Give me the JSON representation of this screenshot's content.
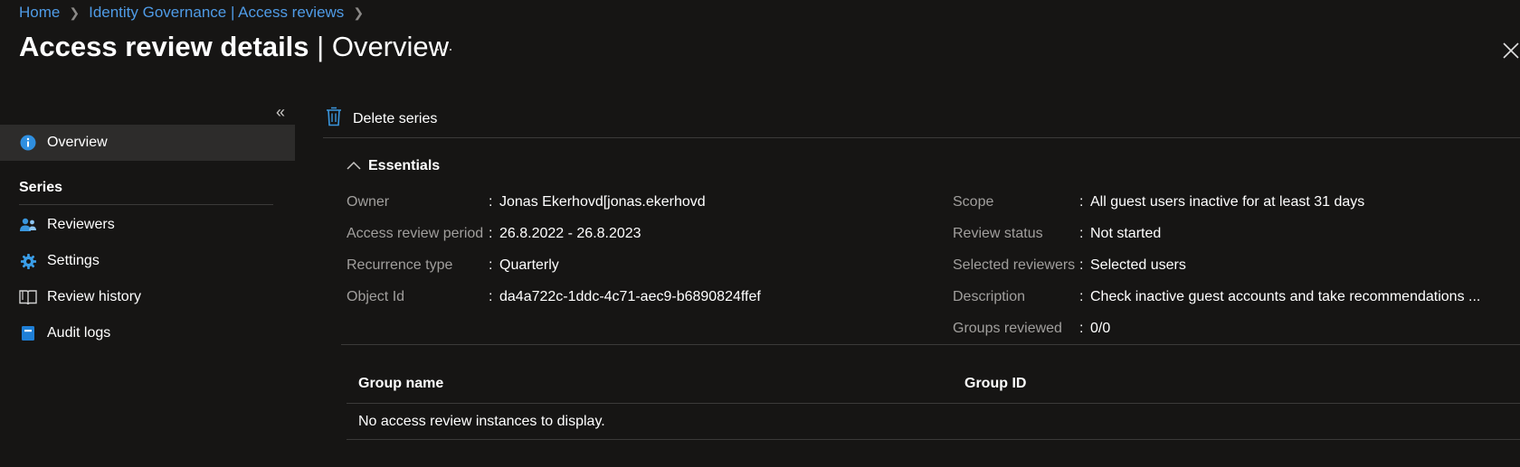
{
  "breadcrumb": {
    "items": [
      "Home",
      "Identity Governance | Access reviews"
    ]
  },
  "header": {
    "title_main": "Access review details",
    "title_separator": " | ",
    "title_sub": "Overview",
    "more_label": "···"
  },
  "sidebar": {
    "collapse_label": "«",
    "overview": "Overview",
    "section_series": "Series",
    "items": [
      {
        "label": "Reviewers",
        "icon": "reviewers-icon"
      },
      {
        "label": "Settings",
        "icon": "gear-icon"
      },
      {
        "label": "Review history",
        "icon": "book-icon"
      },
      {
        "label": "Audit logs",
        "icon": "audit-log-icon"
      }
    ]
  },
  "toolbar": {
    "delete_label": "Delete series"
  },
  "essentials": {
    "title": "Essentials",
    "left": [
      {
        "label": "Owner",
        "value": "Jonas Ekerhovd[jonas.ekerhovd("
      },
      {
        "label": "Access review period",
        "value": "26.8.2022 - 26.8.2023"
      },
      {
        "label": "Recurrence type",
        "value": "Quarterly"
      },
      {
        "label": "Object Id",
        "value": "da4a722c-1ddc-4c71-aec9-b6890824ffef"
      }
    ],
    "right": [
      {
        "label": "Scope",
        "value": "All guest users inactive for at least 31 days"
      },
      {
        "label": "Review status",
        "value": "Not started"
      },
      {
        "label": "Selected reviewers",
        "value": "Selected users"
      },
      {
        "label": "Description",
        "value": "Check inactive guest accounts and take recommendations ..."
      },
      {
        "label": "Groups reviewed",
        "value": "0/0"
      }
    ],
    "colon": ":"
  },
  "table": {
    "columns": [
      "Group name",
      "Group ID"
    ],
    "empty_message": "No access review instances to display."
  },
  "colors": {
    "background": "#161514",
    "link": "#4f9be6",
    "accent": "#0078d4",
    "muted_label": "#a19f9d",
    "active_nav": "#2d2c2b"
  }
}
